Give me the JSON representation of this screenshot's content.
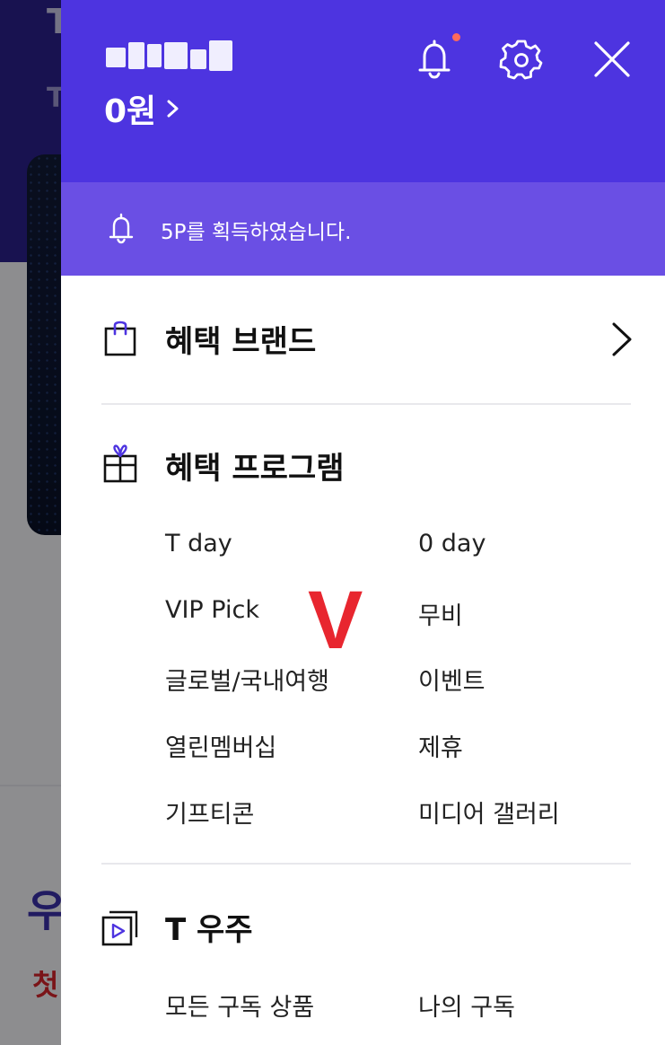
{
  "background": {
    "glyph_top": "T",
    "glyph_second": "T",
    "glyph_u": "우",
    "glyph_cheot": "첫"
  },
  "header": {
    "user_name": "••••",
    "points_label": "0원",
    "icons": [
      "bell-icon",
      "gear-icon",
      "close-icon"
    ],
    "notification_dot": true,
    "accent_color": "#4d34e0"
  },
  "banner": {
    "icon": "bell-icon",
    "text": "5P를 획득하였습니다.",
    "color": "#6a4fe4"
  },
  "sections": {
    "brand": {
      "title": "혜택 브랜드",
      "icon": "shopping-bag-icon"
    },
    "program": {
      "title": "혜택 프로그램",
      "icon": "gift-icon",
      "items": [
        "T day",
        "0 day",
        "VIP Pick",
        "무비",
        "글로벌/국내여행",
        "이벤트",
        "열린멤버십",
        "제휴",
        "기프티콘",
        "미디어 갤러리"
      ]
    },
    "universe": {
      "title": "T 우주",
      "icon": "subscription-play-icon",
      "items": [
        "모든 구독 상품",
        "나의 구독"
      ]
    }
  },
  "overlay_mark": "V"
}
